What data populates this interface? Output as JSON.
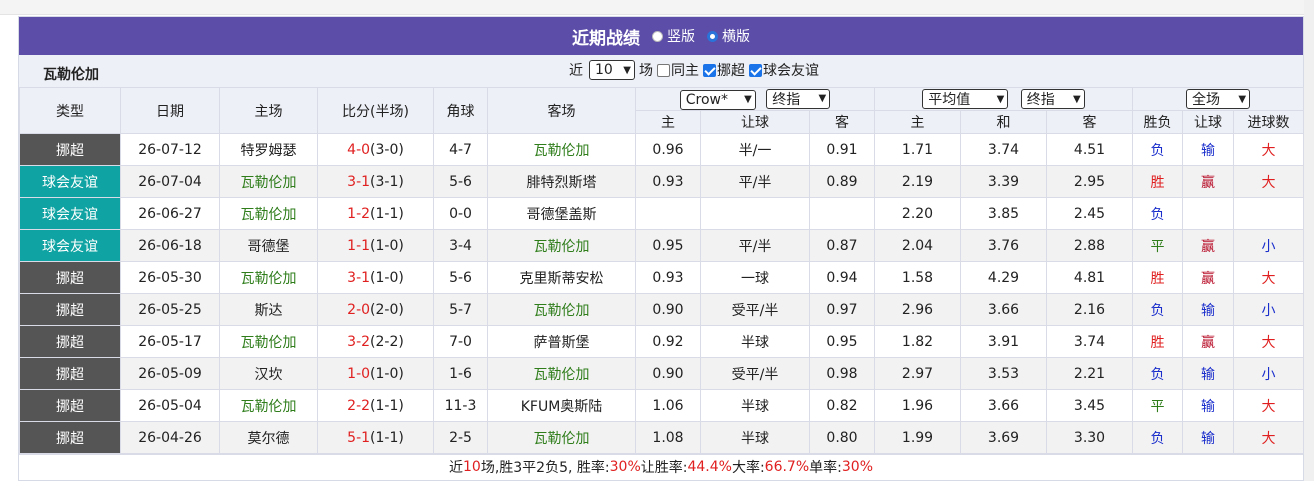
{
  "top_strip_text": "",
  "title": "近期战绩",
  "layout_options": [
    {
      "label": "竖版",
      "selected": false
    },
    {
      "label": "横版",
      "selected": true
    }
  ],
  "team_name": "瓦勒伦加",
  "filters": {
    "prefix": "近",
    "count_value": "10",
    "suffix": "场",
    "same_host_label": "同主",
    "same_host_checked": false,
    "league_label": "挪超",
    "league_checked": true,
    "friendly_label": "球会友谊",
    "friendly_checked": true
  },
  "headers": {
    "type": "类型",
    "date": "日期",
    "home": "主场",
    "score": "比分(半场)",
    "corner": "角球",
    "away": "客场",
    "company_select": "Crow*",
    "handicap_select": "终指",
    "avg_select": "平均值",
    "odds_select": "终指",
    "range_select": "全场",
    "sub_home": "主",
    "sub_handicap": "让球",
    "sub_away": "客",
    "sub_ohome": "主",
    "sub_draw": "和",
    "sub_oaway": "客",
    "sub_result": "胜负",
    "sub_hresult": "让球",
    "sub_goals": "进球数"
  },
  "rows": [
    {
      "type": "挪超",
      "type_kind": "league",
      "date": "26-07-12",
      "home": "特罗姆瑟",
      "home_hl": false,
      "score": "4-0",
      "half": "(3-0)",
      "corner": "4-7",
      "away": "瓦勒伦加",
      "away_hl": true,
      "h": "0.96",
      "line": "半/一",
      "a": "0.91",
      "oh": "1.71",
      "od": "3.74",
      "oa": "4.51",
      "res": "负",
      "hres": "输",
      "goals": "大"
    },
    {
      "type": "球会友谊",
      "type_kind": "friendly",
      "date": "26-07-04",
      "home": "瓦勒伦加",
      "home_hl": true,
      "score": "3-1",
      "half": "(3-1)",
      "corner": "5-6",
      "away": "腓特烈斯塔",
      "away_hl": false,
      "h": "0.93",
      "line": "平/半",
      "a": "0.89",
      "oh": "2.19",
      "od": "3.39",
      "oa": "2.95",
      "res": "胜",
      "hres": "赢",
      "goals": "大"
    },
    {
      "type": "球会友谊",
      "type_kind": "friendly",
      "date": "26-06-27",
      "home": "瓦勒伦加",
      "home_hl": true,
      "score": "1-2",
      "half": "(1-1)",
      "corner": "0-0",
      "away": "哥德堡盖斯",
      "away_hl": false,
      "h": "",
      "line": "",
      "a": "",
      "oh": "2.20",
      "od": "3.85",
      "oa": "2.45",
      "res": "负",
      "hres": "",
      "goals": ""
    },
    {
      "type": "球会友谊",
      "type_kind": "friendly",
      "date": "26-06-18",
      "home": "哥德堡",
      "home_hl": false,
      "score": "1-1",
      "half": "(1-0)",
      "corner": "3-4",
      "away": "瓦勒伦加",
      "away_hl": true,
      "h": "0.95",
      "line": "平/半",
      "a": "0.87",
      "oh": "2.04",
      "od": "3.76",
      "oa": "2.88",
      "res": "平",
      "hres": "赢",
      "goals": "小"
    },
    {
      "type": "挪超",
      "type_kind": "league",
      "date": "26-05-30",
      "home": "瓦勒伦加",
      "home_hl": true,
      "score": "3-1",
      "half": "(1-0)",
      "corner": "5-6",
      "away": "克里斯蒂安松",
      "away_hl": false,
      "h": "0.93",
      "line": "一球",
      "a": "0.94",
      "oh": "1.58",
      "od": "4.29",
      "oa": "4.81",
      "res": "胜",
      "hres": "赢",
      "goals": "大"
    },
    {
      "type": "挪超",
      "type_kind": "league",
      "date": "26-05-25",
      "home": "斯达",
      "home_hl": false,
      "score": "2-0",
      "half": "(2-0)",
      "corner": "5-7",
      "away": "瓦勒伦加",
      "away_hl": true,
      "h": "0.90",
      "line": "受平/半",
      "a": "0.97",
      "oh": "2.96",
      "od": "3.66",
      "oa": "2.16",
      "res": "负",
      "hres": "输",
      "goals": "小"
    },
    {
      "type": "挪超",
      "type_kind": "league",
      "date": "26-05-17",
      "home": "瓦勒伦加",
      "home_hl": true,
      "score": "3-2",
      "half": "(2-2)",
      "corner": "7-0",
      "away": "萨普斯堡",
      "away_hl": false,
      "h": "0.92",
      "line": "半球",
      "a": "0.95",
      "oh": "1.82",
      "od": "3.91",
      "oa": "3.74",
      "res": "胜",
      "hres": "赢",
      "goals": "大"
    },
    {
      "type": "挪超",
      "type_kind": "league",
      "date": "26-05-09",
      "home": "汉坎",
      "home_hl": false,
      "score": "1-0",
      "half": "(1-0)",
      "corner": "1-6",
      "away": "瓦勒伦加",
      "away_hl": true,
      "h": "0.90",
      "line": "受平/半",
      "a": "0.98",
      "oh": "2.97",
      "od": "3.53",
      "oa": "2.21",
      "res": "负",
      "hres": "输",
      "goals": "小"
    },
    {
      "type": "挪超",
      "type_kind": "league",
      "date": "26-05-04",
      "home": "瓦勒伦加",
      "home_hl": true,
      "score": "2-2",
      "half": "(1-1)",
      "corner": "11-3",
      "away": "KFUM奥斯陆",
      "away_hl": false,
      "h": "1.06",
      "line": "半球",
      "a": "0.82",
      "oh": "1.96",
      "od": "3.66",
      "oa": "3.45",
      "res": "平",
      "hres": "输",
      "goals": "大"
    },
    {
      "type": "挪超",
      "type_kind": "league",
      "date": "26-04-26",
      "home": "莫尔德",
      "home_hl": false,
      "score": "5-1",
      "half": "(1-1)",
      "corner": "2-5",
      "away": "瓦勒伦加",
      "away_hl": true,
      "h": "1.08",
      "line": "半球",
      "a": "0.80",
      "oh": "1.99",
      "od": "3.69",
      "oa": "3.30",
      "res": "负",
      "hres": "输",
      "goals": "大"
    }
  ],
  "summary": {
    "pre": "近",
    "games": "10",
    "mid": "场,胜3平2负5, 胜率:",
    "win_rate": "30%",
    "hc_label": " 让胜率:",
    "hc_rate": "44.4%",
    "big_label": " 大率:",
    "big_rate": "66.7%",
    "odd_label": " 单率:",
    "odd_rate": "30%"
  },
  "colors": {
    "title_bg": "#5b4da8",
    "league_bg": "#555555",
    "friendly_bg": "#0fa3a3",
    "win": "#e02020",
    "loss": "#1a2ecc",
    "draw": "#2e7d1a",
    "team_highlight": "#2e7d1a"
  }
}
